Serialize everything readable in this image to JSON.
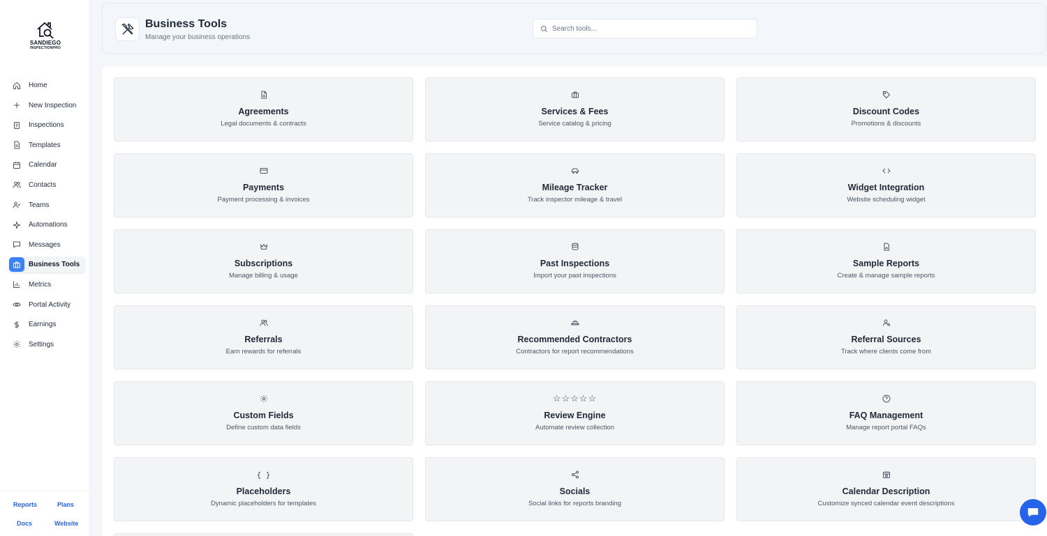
{
  "brand": {
    "line1": "SANDIEGO",
    "line2": "INSPECTIONPRO"
  },
  "colors": {
    "accent": "#3b82f6",
    "link": "#2563eb",
    "card_bg": "#f3f4f6"
  },
  "sidebar": {
    "items": [
      {
        "label": "Home",
        "icon": "home-icon"
      },
      {
        "label": "New Inspection",
        "icon": "plus-icon"
      },
      {
        "label": "Inspections",
        "icon": "clipboard-icon"
      },
      {
        "label": "Templates",
        "icon": "document-icon"
      },
      {
        "label": "Calendar",
        "icon": "calendar-icon"
      },
      {
        "label": "Contacts",
        "icon": "users-icon"
      },
      {
        "label": "Teams",
        "icon": "user-check-icon"
      },
      {
        "label": "Automations",
        "icon": "sparkle-icon"
      },
      {
        "label": "Messages",
        "icon": "message-icon"
      },
      {
        "label": "Business Tools",
        "icon": "briefcase-icon",
        "active": true
      },
      {
        "label": "Metrics",
        "icon": "bar-chart-icon"
      },
      {
        "label": "Portal Activity",
        "icon": "eye-icon"
      },
      {
        "label": "Earnings",
        "icon": "dollar-icon"
      },
      {
        "label": "Settings",
        "icon": "gear-icon"
      }
    ],
    "footer": {
      "reports": "Reports",
      "plans": "Plans",
      "docs": "Docs",
      "website": "Website"
    }
  },
  "header": {
    "icon": "tools-icon",
    "title": "Business Tools",
    "subtitle": "Manage your business operations",
    "search_placeholder": "Search tools..."
  },
  "tools": [
    {
      "title": "Agreements",
      "desc": "Legal documents & contracts",
      "icon": "file-text-icon"
    },
    {
      "title": "Services & Fees",
      "desc": "Service catalog & pricing",
      "icon": "briefcase-icon"
    },
    {
      "title": "Discount Codes",
      "desc": "Promotions & discounts",
      "icon": "tag-icon"
    },
    {
      "title": "Payments",
      "desc": "Payment processing & invoices",
      "icon": "credit-card-icon"
    },
    {
      "title": "Mileage Tracker",
      "desc": "Track inspector mileage & travel",
      "icon": "car-icon"
    },
    {
      "title": "Widget Integration",
      "desc": "Website scheduling widget",
      "icon": "code-icon"
    },
    {
      "title": "Subscriptions",
      "desc": "Manage billing & usage",
      "icon": "crown-icon"
    },
    {
      "title": "Past Inspections",
      "desc": "Import your past inspections",
      "icon": "database-icon"
    },
    {
      "title": "Sample Reports",
      "desc": "Create & manage sample reports",
      "icon": "file-chart-icon"
    },
    {
      "title": "Referrals",
      "desc": "Earn rewards for referrals",
      "icon": "users-icon"
    },
    {
      "title": "Recommended Contractors",
      "desc": "Contractors for report recommendations",
      "icon": "hard-hat-icon"
    },
    {
      "title": "Referral Sources",
      "desc": "Track where clients come from",
      "icon": "user-search-icon"
    },
    {
      "title": "Custom Fields",
      "desc": "Define custom data fields",
      "icon": "gear-icon"
    },
    {
      "title": "Review Engine",
      "desc": "Automate review collection",
      "icon": "five-stars-icon"
    },
    {
      "title": "FAQ Management",
      "desc": "Manage report portal FAQs",
      "icon": "help-circle-icon"
    },
    {
      "title": "Placeholders",
      "desc": "Dynamic placeholders for templates",
      "icon": "braces-icon"
    },
    {
      "title": "Socials",
      "desc": "Social links for reports branding",
      "icon": "share-icon"
    },
    {
      "title": "Calendar Description",
      "desc": "Customize synced calendar event descriptions",
      "icon": "calendar-clock-icon"
    }
  ],
  "chat": {
    "icon": "chat-icon"
  }
}
